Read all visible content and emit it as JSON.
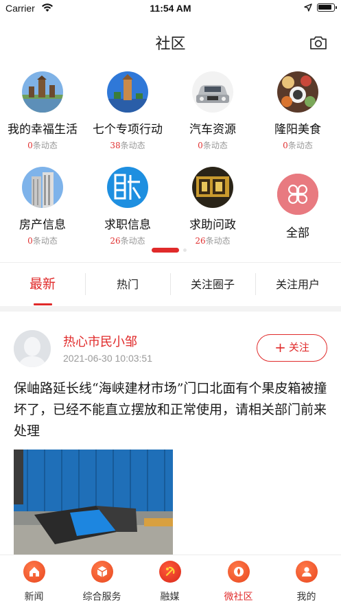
{
  "status_bar": {
    "carrier": "Carrier",
    "time": "11:54 AM"
  },
  "header": {
    "title": "社区"
  },
  "categories": [
    {
      "name": "我的幸福生活",
      "count": "0",
      "suffix": "条动态"
    },
    {
      "name": "七个专项行动",
      "count": "38",
      "suffix": "条动态"
    },
    {
      "name": "汽车资源",
      "count": "0",
      "suffix": "条动态"
    },
    {
      "name": "隆阳美食",
      "count": "0",
      "suffix": "条动态"
    },
    {
      "name": "房产信息",
      "count": "0",
      "suffix": "条动态"
    },
    {
      "name": "求职信息",
      "count": "26",
      "suffix": "条动态"
    },
    {
      "name": "求助问政",
      "count": "26",
      "suffix": "条动态"
    },
    {
      "name": "全部"
    }
  ],
  "feed_tabs": [
    "最新",
    "热门",
    "关注圈子",
    "关注用户"
  ],
  "post": {
    "username": "热心市民小邹",
    "time": "2021-06-30 10:03:51",
    "follow_label": "关注",
    "text": "保岫路延长线“海峡建材市场”门口北面有个果皮箱被撞坏了，已经不能直立摆放和正常使用，请相关部门前来处理"
  },
  "tabbar": [
    {
      "label": "新闻",
      "icon": "home-icon"
    },
    {
      "label": "综合服务",
      "icon": "box-icon"
    },
    {
      "label": "融媒",
      "icon": "party-emblem-icon"
    },
    {
      "label": "微社区",
      "icon": "community-icon",
      "active": true
    },
    {
      "label": "我的",
      "icon": "user-icon"
    }
  ],
  "colors": {
    "accent": "#e02a2a",
    "tab_icon": "#ee5a2c"
  }
}
